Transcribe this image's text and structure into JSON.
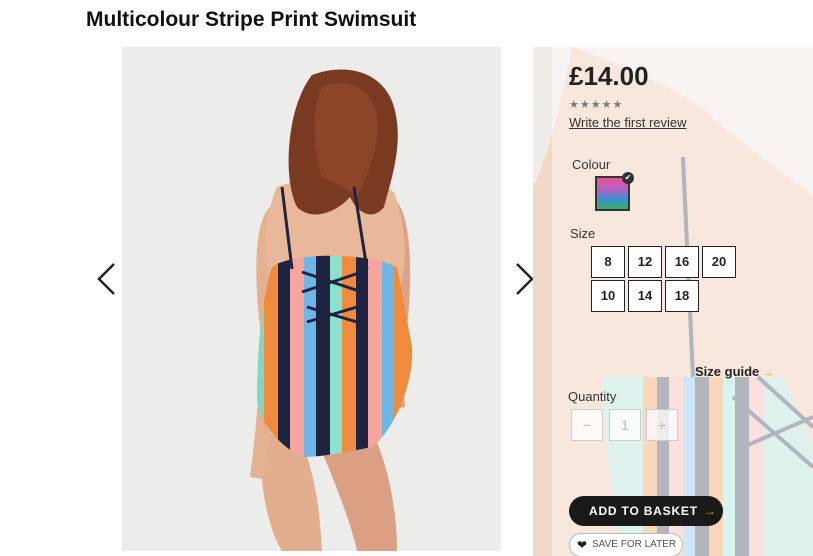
{
  "product": {
    "title": "Multicolour Stripe Print Swimsuit",
    "price": "£14.00",
    "rating": "★★★★★",
    "review_link": "Write the first review"
  },
  "colour": {
    "label": "Colour",
    "selected_swatch": "multicolour-stripe"
  },
  "size": {
    "label": "Size",
    "options": [
      "8",
      "12",
      "16",
      "20",
      "10",
      "14",
      "18"
    ],
    "guide_label": "Size guide",
    "guide_arrow": "→"
  },
  "quantity": {
    "label": "Quantity",
    "decrement": "−",
    "value": "1",
    "increment": "+"
  },
  "actions": {
    "add_to_basket": "ADD TO BASKET",
    "add_arrow": "→",
    "save_for_later": "SAVE FOR LATER",
    "heart": "❤"
  },
  "icons": {
    "prev": "chevron-left-icon",
    "next": "chevron-right-icon",
    "check": "✔"
  },
  "colors": {
    "accent": "#e6a100",
    "button": "#1a1a1a"
  }
}
